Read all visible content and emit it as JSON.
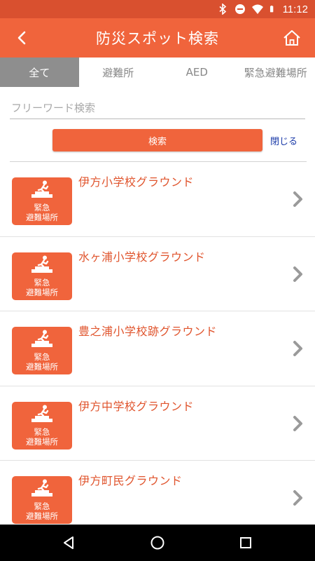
{
  "status_bar": {
    "time": "11:12"
  },
  "app_bar": {
    "title": "防災スポット検索"
  },
  "tabs": [
    {
      "label": "全て",
      "active": true
    },
    {
      "label": "避難所",
      "active": false
    },
    {
      "label": "AED",
      "active": false
    },
    {
      "label": "緊急避難場所",
      "active": false
    }
  ],
  "search": {
    "placeholder": "フリーワード検索",
    "value": "",
    "button_label": "検索",
    "close_label": "閉じる"
  },
  "badge": {
    "line1": "緊急",
    "line2": "避難場所",
    "icon": "emergency-exit-icon"
  },
  "spots": [
    {
      "name": "伊方小学校グラウンド"
    },
    {
      "name": "水ヶ浦小学校グラウンド"
    },
    {
      "name": "豊之浦小学校跡グラウンド"
    },
    {
      "name": "伊方中学校グラウンド"
    },
    {
      "name": "伊方町民グラウンド"
    }
  ],
  "colors": {
    "primary": "#f0643c",
    "status_bar": "#d9502f",
    "tab_active": "#8e8e8e",
    "spot_name": "#e0552e",
    "link": "#1a3aa8"
  }
}
